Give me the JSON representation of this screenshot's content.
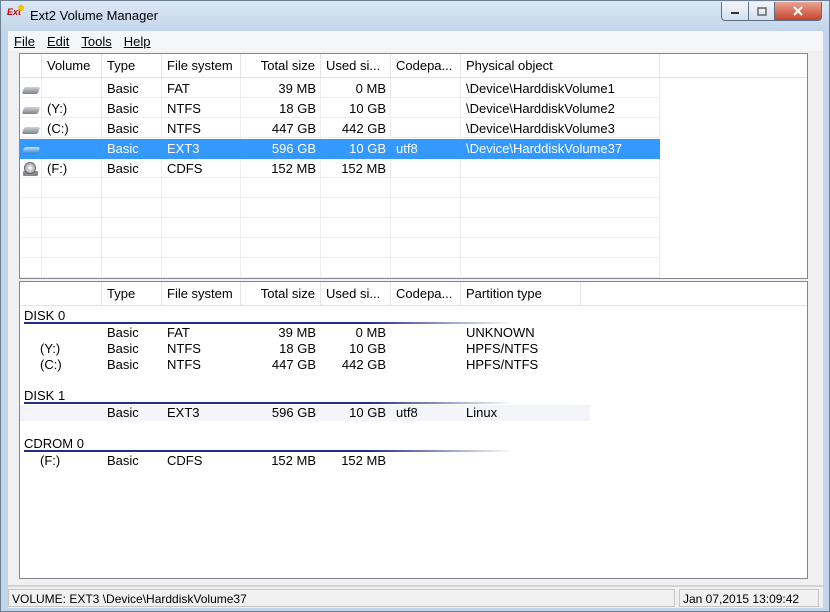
{
  "window": {
    "title": "Ext2 Volume Manager",
    "icon_name": "ext2-app-icon"
  },
  "menu": [
    {
      "label": "File"
    },
    {
      "label": "Edit"
    },
    {
      "label": "Tools"
    },
    {
      "label": "Help"
    }
  ],
  "volumes": {
    "columns": [
      "Volume",
      "Type",
      "File system",
      "Total size",
      "Used si...",
      "Codepa...",
      "Physical object"
    ],
    "rows": [
      {
        "icon": "hard-drive-icon",
        "volume": "",
        "type": "Basic",
        "fs": "FAT",
        "total": "39 MB",
        "used": "0 MB",
        "codepage": "",
        "physical": "\\Device\\HarddiskVolume1",
        "selected": false
      },
      {
        "icon": "hard-drive-icon",
        "volume": "(Y:)",
        "type": "Basic",
        "fs": "NTFS",
        "total": "18 GB",
        "used": "10 GB",
        "codepage": "",
        "physical": "\\Device\\HarddiskVolume2",
        "selected": false
      },
      {
        "icon": "hard-drive-icon",
        "volume": "(C:)",
        "type": "Basic",
        "fs": "NTFS",
        "total": "447 GB",
        "used": "442 GB",
        "codepage": "",
        "physical": "\\Device\\HarddiskVolume3",
        "selected": false
      },
      {
        "icon": "hard-drive-icon",
        "volume": "",
        "type": "Basic",
        "fs": "EXT3",
        "total": "596 GB",
        "used": "10 GB",
        "codepage": "utf8",
        "physical": "\\Device\\HarddiskVolume37",
        "selected": true
      },
      {
        "icon": "cdrom-icon",
        "volume": "(F:)",
        "type": "Basic",
        "fs": "CDFS",
        "total": "152 MB",
        "used": "152 MB",
        "codepage": "",
        "physical": "",
        "selected": false
      }
    ]
  },
  "disks": {
    "columns": [
      "",
      "Type",
      "File system",
      "Total size",
      "Used si...",
      "Codepa...",
      "Partition type"
    ],
    "groups": [
      {
        "name": "DISK 0",
        "rows": [
          {
            "volume": "",
            "type": "Basic",
            "fs": "FAT",
            "total": "39 MB",
            "used": "0 MB",
            "codepage": "",
            "ptype": "UNKNOWN"
          },
          {
            "volume": "(Y:)",
            "type": "Basic",
            "fs": "NTFS",
            "total": "18 GB",
            "used": "10 GB",
            "codepage": "",
            "ptype": "HPFS/NTFS"
          },
          {
            "volume": "(C:)",
            "type": "Basic",
            "fs": "NTFS",
            "total": "447 GB",
            "used": "442 GB",
            "codepage": "",
            "ptype": "HPFS/NTFS"
          }
        ]
      },
      {
        "name": "DISK 1",
        "rows": [
          {
            "volume": "",
            "type": "Basic",
            "fs": "EXT3",
            "total": "596 GB",
            "used": "10 GB",
            "codepage": "utf8",
            "ptype": "Linux"
          }
        ]
      },
      {
        "name": "CDROM 0",
        "rows": [
          {
            "volume": "(F:)",
            "type": "Basic",
            "fs": "CDFS",
            "total": "152 MB",
            "used": "152 MB",
            "codepage": "",
            "ptype": ""
          }
        ]
      }
    ]
  },
  "status": {
    "left": "VOLUME:  EXT3 \\Device\\HarddiskVolume37",
    "right": "Jan 07,2015 13:09:42"
  },
  "colors": {
    "selection": "#3399ff",
    "disk_line": "#1f2f86",
    "titlebar": "#c4d6eb"
  }
}
